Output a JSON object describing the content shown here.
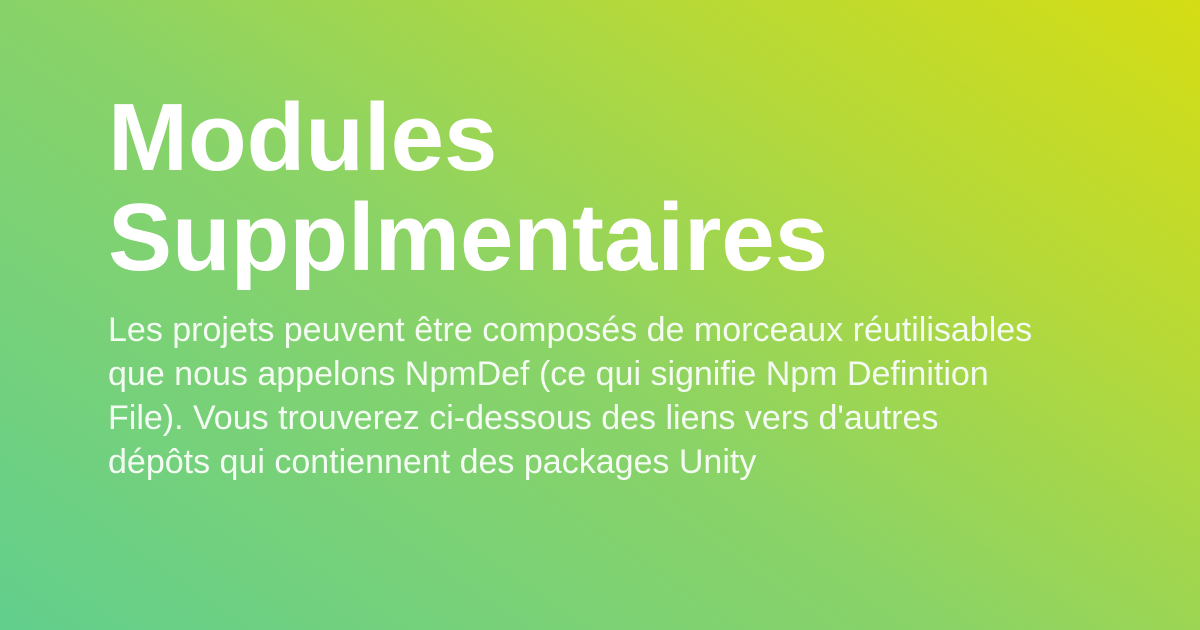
{
  "card": {
    "title_line_1": "Modules",
    "title_line_2": "Supplmentaires",
    "description": "Les projets peuvent être composés de morceaux réutilisables que nous appelons NpmDef (ce qui signifie Npm Definition File). Vous trouverez ci-dessous des liens vers d'autres dépôts qui contiennent des packages Unity"
  },
  "colors": {
    "gradient_start": "#62cf8d",
    "gradient_end": "#d5dd14",
    "text": "#ffffff"
  }
}
